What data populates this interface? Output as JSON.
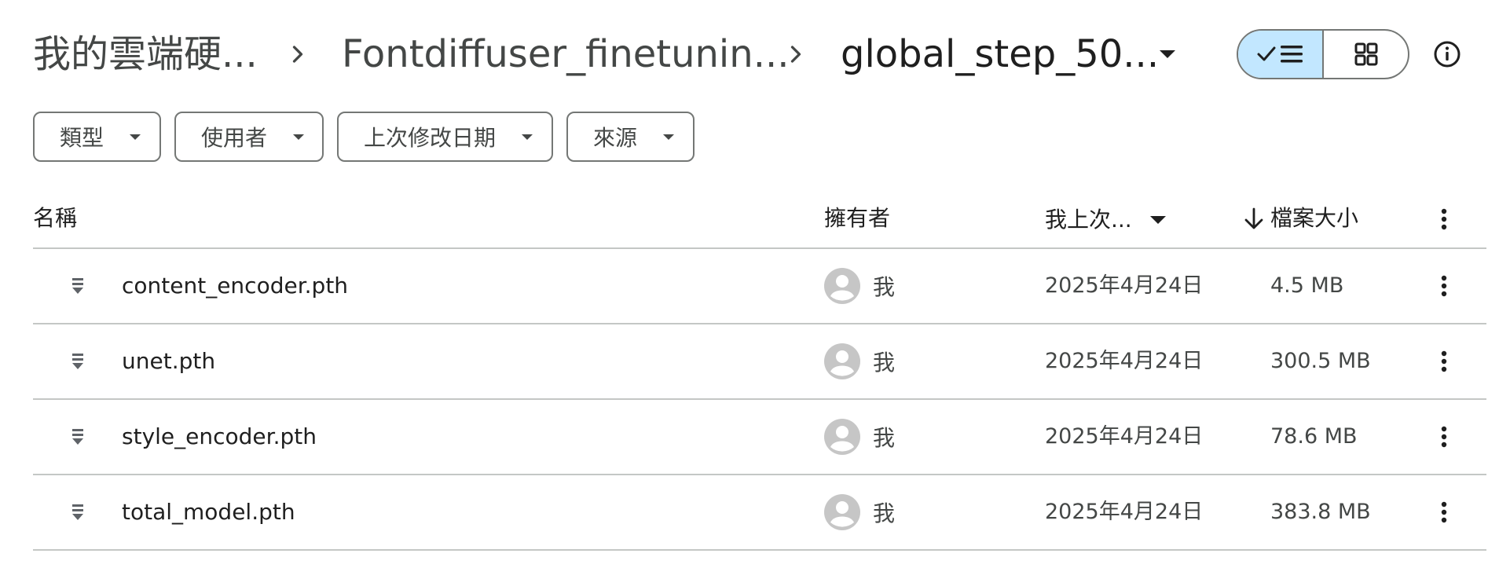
{
  "breadcrumb": {
    "items": [
      "我的雲端硬...",
      "Fontdiffuser_finetunin...",
      "global_step_50..."
    ]
  },
  "view_toggle": {
    "list_icon": "check-list-icon",
    "grid_icon": "grid-icon",
    "active": "list",
    "accent_color": "#c2e7ff"
  },
  "info_icon": "info-icon",
  "filters": [
    {
      "label": "類型"
    },
    {
      "label": "使用者"
    },
    {
      "label": "上次修改日期"
    },
    {
      "label": "來源"
    }
  ],
  "table": {
    "headers": {
      "name": "名稱",
      "owner": "擁有者",
      "modified": "我上次...",
      "size": "檔案大小"
    },
    "sort_direction": "descending",
    "rows": [
      {
        "name": "content_encoder.pth",
        "owner": "我",
        "modified": "2025年4月24日",
        "size": "4.5 MB"
      },
      {
        "name": "unet.pth",
        "owner": "我",
        "modified": "2025年4月24日",
        "size": "300.5 MB"
      },
      {
        "name": "style_encoder.pth",
        "owner": "我",
        "modified": "2025年4月24日",
        "size": "78.6 MB"
      },
      {
        "name": "total_model.pth",
        "owner": "我",
        "modified": "2025年4月24日",
        "size": "383.8 MB"
      }
    ]
  }
}
